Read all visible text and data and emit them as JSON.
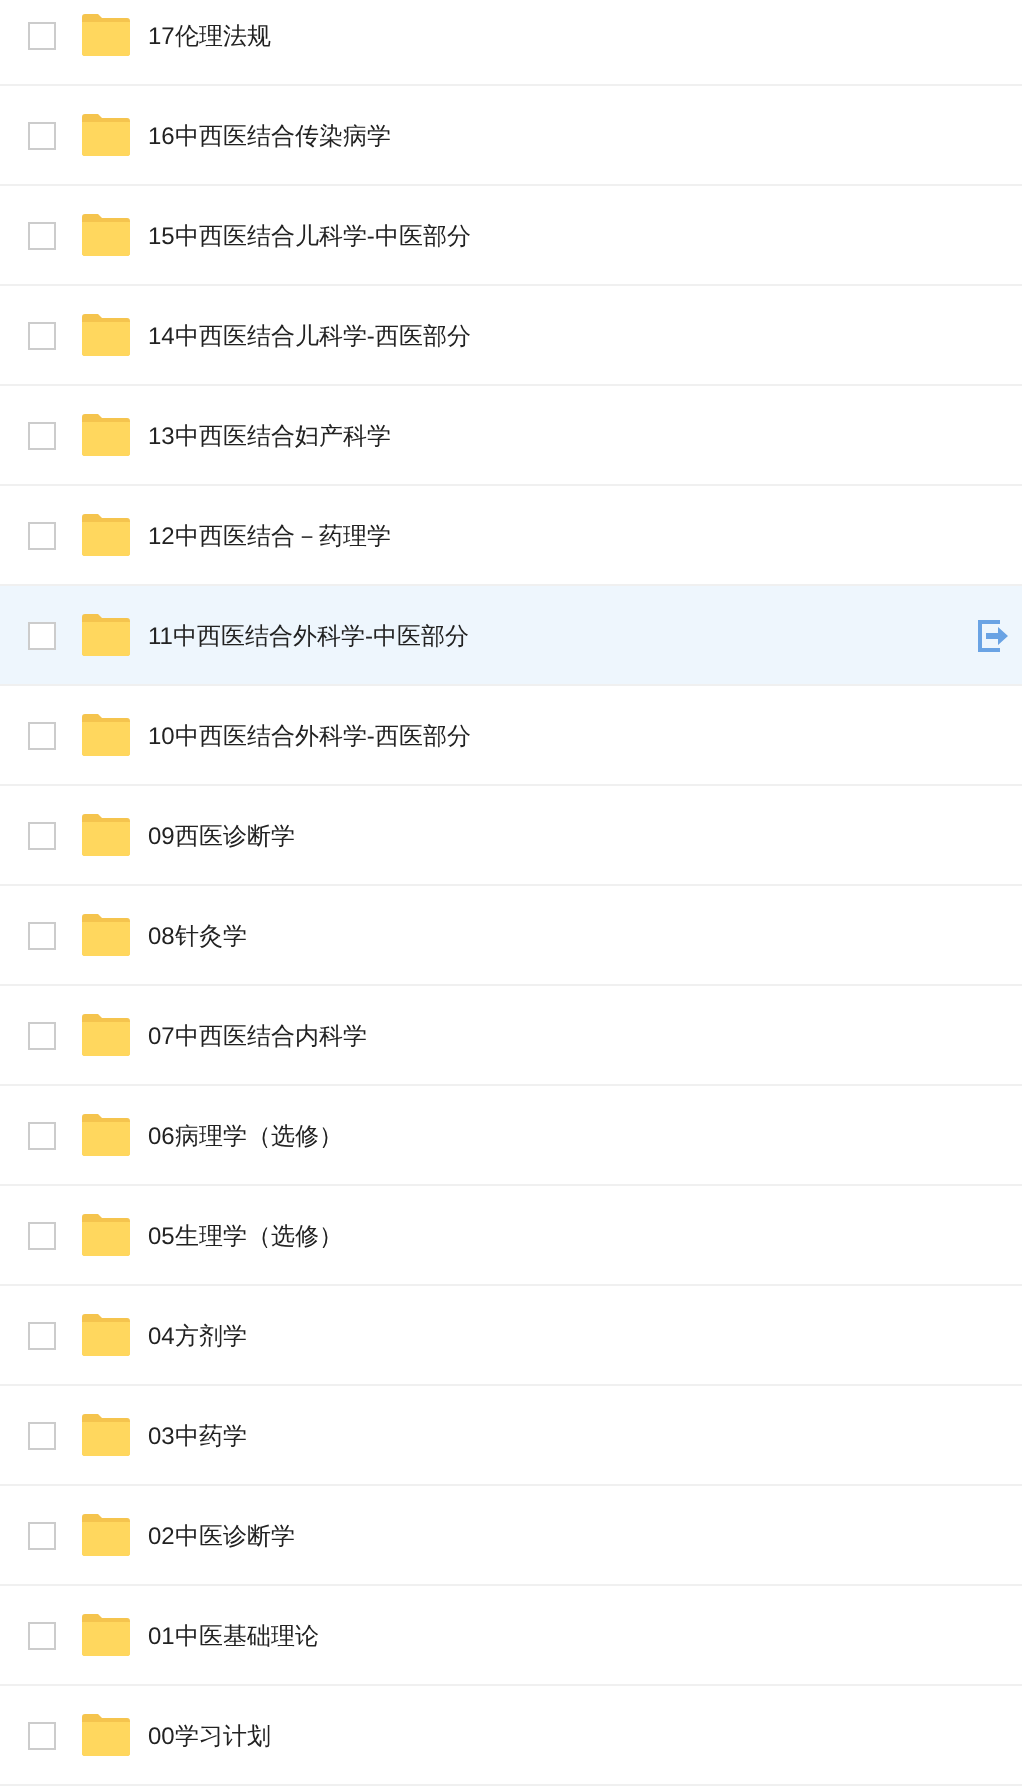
{
  "folders": [
    {
      "name": "17伦理法规",
      "checked": false,
      "highlighted": false
    },
    {
      "name": "16中西医结合传染病学",
      "checked": false,
      "highlighted": false
    },
    {
      "name": "15中西医结合儿科学-中医部分",
      "checked": false,
      "highlighted": false
    },
    {
      "name": "14中西医结合儿科学-西医部分",
      "checked": false,
      "highlighted": false
    },
    {
      "name": "13中西医结合妇产科学",
      "checked": false,
      "highlighted": false
    },
    {
      "name": "12中西医结合－药理学",
      "checked": false,
      "highlighted": false
    },
    {
      "name": "11中西医结合外科学-中医部分",
      "checked": false,
      "highlighted": true
    },
    {
      "name": "10中西医结合外科学-西医部分",
      "checked": false,
      "highlighted": false
    },
    {
      "name": "09西医诊断学",
      "checked": false,
      "highlighted": false
    },
    {
      "name": "08针灸学",
      "checked": false,
      "highlighted": false
    },
    {
      "name": "07中西医结合内科学",
      "checked": false,
      "highlighted": false
    },
    {
      "name": "06病理学（选修）",
      "checked": false,
      "highlighted": false
    },
    {
      "name": "05生理学（选修）",
      "checked": false,
      "highlighted": false
    },
    {
      "name": "04方剂学",
      "checked": false,
      "highlighted": false
    },
    {
      "name": "03中药学",
      "checked": false,
      "highlighted": false
    },
    {
      "name": "02中医诊断学",
      "checked": false,
      "highlighted": false
    },
    {
      "name": "01中医基础理论",
      "checked": false,
      "highlighted": false
    },
    {
      "name": "00学习计划",
      "checked": false,
      "highlighted": false
    }
  ]
}
